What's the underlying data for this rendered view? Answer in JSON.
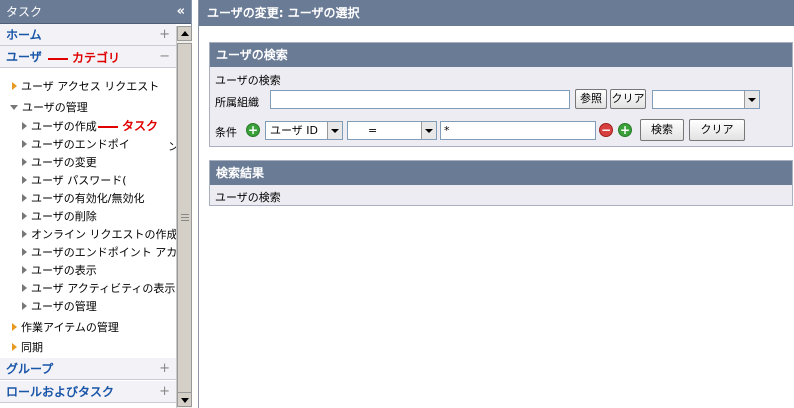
{
  "left": {
    "title": "タスク",
    "collapse_glyph": "«",
    "categories": {
      "home": "ホーム",
      "user": "ユーザ",
      "group": "グループ",
      "roles": "ロールおよびタスク"
    },
    "toggle_plus": "+",
    "toggle_minus": "−",
    "annotation_category": "カテゴリ",
    "annotation_task": "タスク",
    "tree": {
      "user_access_request": "ユーザ アクセス リクエスト",
      "user_management": "ユーザの管理",
      "items": [
        "ユーザの作成",
        "ユーザのエンドポイ",
        "ユーザの変更",
        "ユーザ パスワード(",
        "ユーザの有効化/無効化",
        "ユーザの削除",
        "オンライン リクエストの作成",
        "ユーザのエンドポイント アカウン",
        "ユーザの表示",
        "ユーザ アクティビティの表示",
        "ユーザの管理"
      ],
      "overflow_glyph": "ン",
      "work_items": "作業アイテムの管理",
      "sync": "同期"
    }
  },
  "main": {
    "title": "ユーザの変更: ユーザの選択",
    "search": {
      "header": "ユーザの検索",
      "subheader": "ユーザの検索",
      "org_label": "所属組織",
      "org_value": "",
      "browse_button": "参照",
      "clear_button_small": "クリア",
      "org_select_value": "",
      "condition_label": "条件",
      "field_select": "ユーザ ID",
      "operator_select": "=",
      "value": "*",
      "search_button": "検索",
      "clear_button": "クリア"
    },
    "results": {
      "header": "検索結果",
      "subheader": "ユーザの検索"
    }
  },
  "colors": {
    "header_bg": "#6a7b96",
    "category_text": "#1a56a8",
    "annotation": "#e00000"
  }
}
